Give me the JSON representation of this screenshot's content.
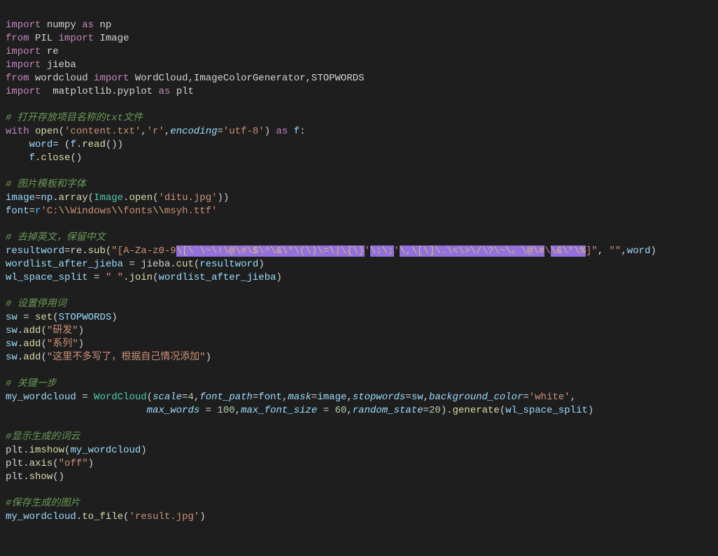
{
  "code": {
    "l1": {
      "kw1": "import",
      "mod": "numpy",
      "kw2": "as",
      "alias": "np"
    },
    "l2": {
      "kw1": "from",
      "mod": "PIL",
      "kw2": "import",
      "name": "Image"
    },
    "l3": {
      "kw1": "import",
      "mod": "re"
    },
    "l4": {
      "kw1": "import",
      "mod": "jieba"
    },
    "l5": {
      "kw1": "from",
      "mod": "wordcloud",
      "kw2": "import",
      "names": "WordCloud,ImageColorGenerator,STOPWORDS"
    },
    "l6": {
      "kw1": "import",
      "sp": "  ",
      "mod": "matplotlib.pyplot",
      "kw2": "as",
      "alias": "plt"
    },
    "c1": "# 打开存放项目名称的txt文件",
    "l8": {
      "kw1": "with",
      "fn": "open",
      "s1": "'content.txt'",
      "s2": "'r'",
      "p": "encoding",
      "s3": "'utf-8'",
      "kw2": "as",
      "var": "f",
      ":": ":"
    },
    "l9": {
      "indent": "    ",
      "var": "word",
      "op": "=",
      "delim": " (",
      "obj": "f",
      "dot": ".",
      "fn": "read",
      "close": "())"
    },
    "l10": {
      "indent": "    ",
      "obj": "f",
      "dot": ".",
      "fn": "close",
      "close": "()"
    },
    "c2": "# 图片模板和字体",
    "l12": {
      "var": "image",
      "op": "=",
      "obj": "np",
      "fn": "array",
      "cls": "Image",
      "fn2": "open",
      "str": "'ditu.jpg'"
    },
    "l13": {
      "var": "font",
      "op": "=",
      "r": "r",
      "q": "'",
      "s1": "C:",
      "e1": "\\\\",
      "s2": "Windows",
      "e2": "\\\\",
      "s3": "fonts",
      "e3": "\\\\",
      "s4": "msyh.ttf",
      "q2": "'"
    },
    "c3": "# 去掉英文，保留中文",
    "l15": {
      "var": "resultword",
      "op": "=",
      "obj": "re",
      "fn": "sub",
      "q": "\"",
      "reg_start": "[A-Za-z0-9",
      "esc": "\\[\\`\\~\\!\\@\\#\\$\\^\\&\\*\\(\\)\\=\\|\\{\\}",
      "mid": "'",
      "esc2": "\\:\\;",
      "mid2": "'",
      "esc3": "\\,\\[\\]\\.\\<\\>\\/\\?\\~\\。\\@\\#",
      "mid3": "\\",
      "esc4": "\\&\\*\\%",
      "reg_end": "]",
      "q2": "\"",
      "s2": "\"\"",
      "var2": "word"
    },
    "l16": {
      "var": "wordlist_after_jieba",
      "op": " = ",
      "obj": "jieba",
      "fn": "cut",
      "arg": "resultword"
    },
    "l17": {
      "var": "wl_space_split",
      "op": " = ",
      "str": "\" \"",
      "fn": "join",
      "arg": "wordlist_after_jieba"
    },
    "c4": "# 设置停用词",
    "l19": {
      "var": "sw",
      "op": " = ",
      "fn": "set",
      "arg": "STOPWORDS"
    },
    "l20": {
      "obj": "sw",
      "fn": "add",
      "str": "\"研发\""
    },
    "l21": {
      "obj": "sw",
      "fn": "add",
      "str": "\"系列\""
    },
    "l22": {
      "obj": "sw",
      "fn": "add",
      "str": "\"这里不多写了，根据自己情况添加\""
    },
    "c5": "# 关键一步",
    "l24": {
      "var": "my_wordcloud",
      "op": " = ",
      "cls": "WordCloud",
      "p1": "scale",
      "n1": "4",
      "p2": "font_path",
      "v2": "font",
      "p3": "mask",
      "v3": "image",
      "p4": "stopwords",
      "v4": "sw",
      "p5": "background_color",
      "s5": "'white'"
    },
    "l25": {
      "indent": "                        ",
      "p1": "max_words",
      "op1": " = ",
      "n1": "100",
      "p2": "max_font_size",
      "op2": " = ",
      "n2": "60",
      "p3": "random_state",
      "n3": "20",
      "fn": "generate",
      "arg": "wl_space_split"
    },
    "c6": "#显示生成的词云",
    "l27": {
      "obj": "plt",
      "fn": "imshow",
      "arg": "my_wordcloud"
    },
    "l28": {
      "obj": "plt",
      "fn": "axis",
      "str": "\"off\""
    },
    "l29": {
      "obj": "plt",
      "fn": "show"
    },
    "c7": "#保存生成的图片",
    "l31": {
      "obj": "my_wordcloud",
      "fn": "to_file",
      "str": "'result.jpg'"
    }
  }
}
